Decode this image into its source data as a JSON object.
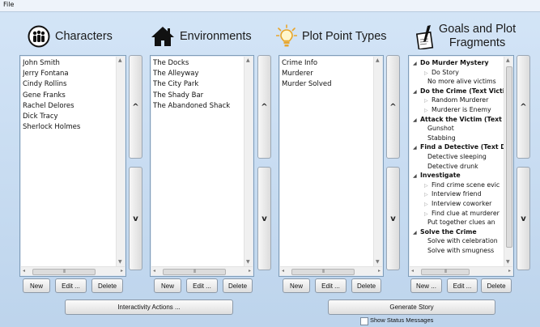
{
  "menu": {
    "file": "File"
  },
  "characters": {
    "title": "Characters",
    "items": [
      "John Smith",
      "Jerry Fontana",
      "Cindy Rollins",
      "Gene Franks",
      "Rachel Delores",
      "Dick Tracy",
      "Sherlock Holmes"
    ],
    "new": "New",
    "edit": "Edit ...",
    "delete": "Delete"
  },
  "environments": {
    "title": "Environments",
    "items": [
      "The Docks",
      "The Alleyway",
      "The City Park",
      "The Shady Bar",
      "The Abandoned Shack"
    ],
    "new": "New",
    "edit": "Edit ...",
    "delete": "Delete"
  },
  "plotPointTypes": {
    "title": "Plot Point Types",
    "items": [
      "Crime Info",
      "Murderer",
      "Murder Solved"
    ],
    "new": "New",
    "edit": "Edit ...",
    "delete": "Delete"
  },
  "goals": {
    "title_line1": "Goals and Plot",
    "title_line2": "Fragments",
    "tree": [
      {
        "level": 0,
        "text": "Do Murder Mystery",
        "toggle": "expanded"
      },
      {
        "level": 1,
        "text": "Do Story",
        "toggle": "collapsed"
      },
      {
        "level": 2,
        "text": "No more alive victims",
        "toggle": "none"
      },
      {
        "level": 0,
        "text": "Do the Crime (Text Victi",
        "toggle": "expanded"
      },
      {
        "level": 1,
        "text": "Random Murderer",
        "toggle": "collapsed"
      },
      {
        "level": 1,
        "text": "Murderer is Enemy",
        "toggle": "collapsed"
      },
      {
        "level": 0,
        "text": "Attack the Victim (Text",
        "toggle": "expanded"
      },
      {
        "level": 2,
        "text": "Gunshot",
        "toggle": "none"
      },
      {
        "level": 2,
        "text": "Stabbing",
        "toggle": "none"
      },
      {
        "level": 0,
        "text": "Find a Detective (Text D",
        "toggle": "expanded"
      },
      {
        "level": 2,
        "text": "Detective sleeping",
        "toggle": "none"
      },
      {
        "level": 2,
        "text": "Detective drunk",
        "toggle": "none"
      },
      {
        "level": 0,
        "text": "Investigate",
        "toggle": "expanded"
      },
      {
        "level": 1,
        "text": "Find crime scene evic",
        "toggle": "collapsed"
      },
      {
        "level": 1,
        "text": "Interview friend",
        "toggle": "collapsed"
      },
      {
        "level": 1,
        "text": "Interview coworker",
        "toggle": "collapsed"
      },
      {
        "level": 1,
        "text": "Find clue at murderer",
        "toggle": "collapsed"
      },
      {
        "level": 2,
        "text": "Put together clues an",
        "toggle": "none"
      },
      {
        "level": 0,
        "text": "Solve the Crime",
        "toggle": "expanded"
      },
      {
        "level": 2,
        "text": "Solve with celebration",
        "toggle": "none"
      },
      {
        "level": 2,
        "text": "Solve with smugness",
        "toggle": "none"
      }
    ],
    "new": "New ...",
    "edit": "Edit ...",
    "delete": "Delete"
  },
  "scroll": {
    "up": "^",
    "down": "v"
  },
  "icons": {
    "characters": "group-icon",
    "environments": "house-icon",
    "plotPointTypes": "lightbulb-icon",
    "goals": "pen-paper-icon"
  },
  "bottom": {
    "interactivity": "Interactivity Actions ...",
    "generate": "Generate Story",
    "showStatus": "Show Status Messages"
  }
}
